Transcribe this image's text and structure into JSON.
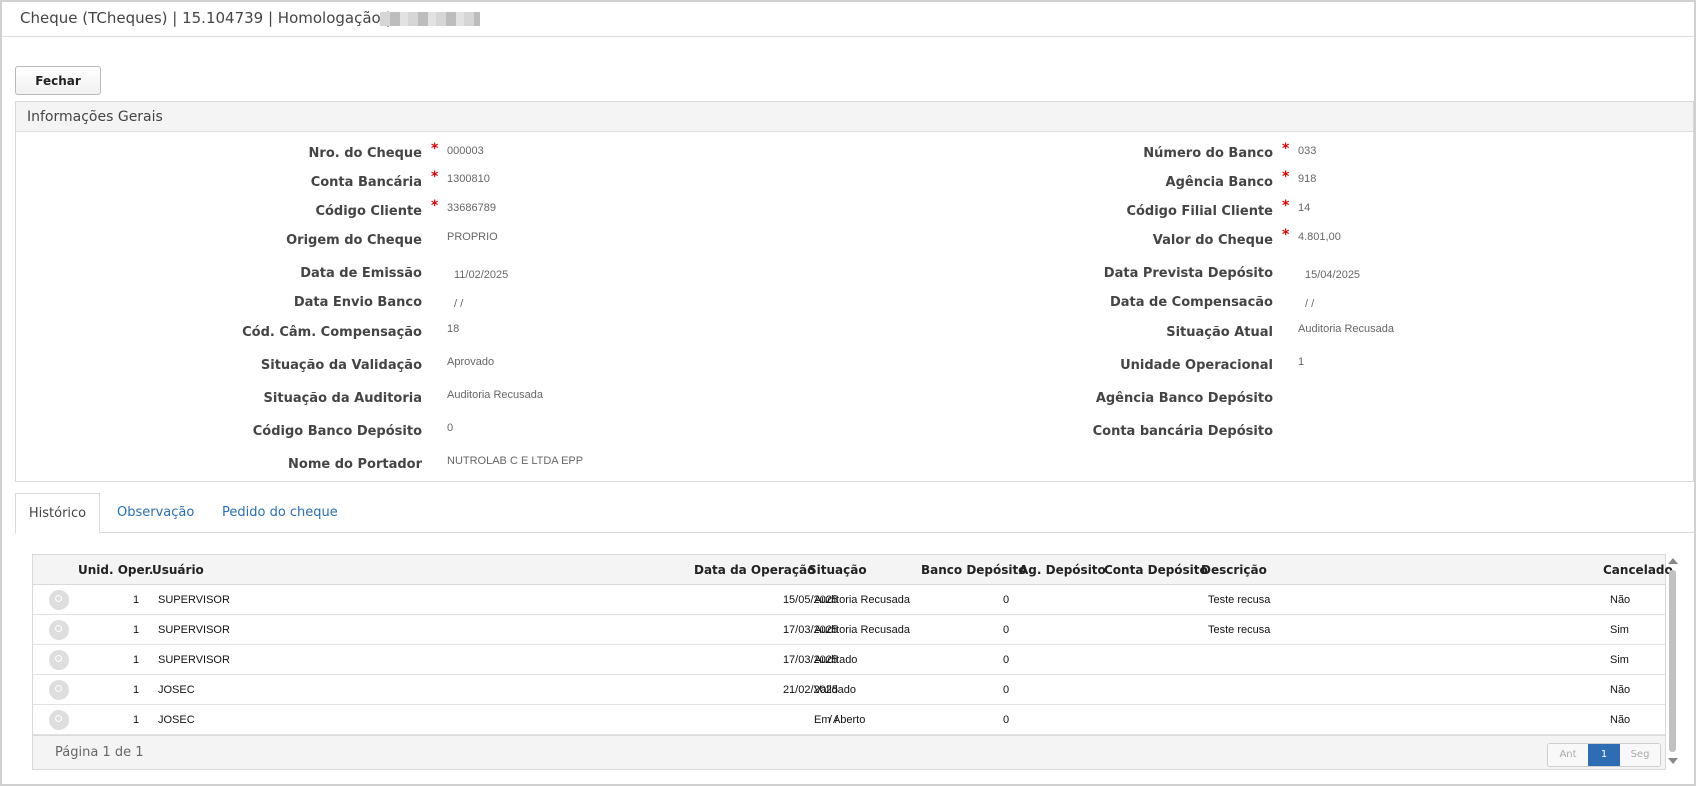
{
  "window": {
    "title": "Cheque (TCheques) | 15.104739 | Homologação |",
    "redacted_icon": "redacted-text"
  },
  "toolbar": {
    "close_label": "Fechar"
  },
  "panel": {
    "title": "Informações Gerais",
    "left_fields": [
      {
        "label": "Nro. do Cheque",
        "value": "000003",
        "required": "*"
      },
      {
        "label": "Conta Bancária",
        "value": "1300810",
        "required": "*"
      },
      {
        "label": "Código Cliente",
        "value": "33686789",
        "required": "*"
      },
      {
        "label": "Origem do Cheque",
        "value": "PROPRIO"
      },
      {
        "label": "Data de Emissão",
        "value": "11/02/2025"
      },
      {
        "label": "Data Envio Banco",
        "value": "/ /"
      },
      {
        "label": "Cód. Câm. Compensação",
        "value": "18"
      },
      {
        "label": "Situação da Validação",
        "value": "Aprovado"
      },
      {
        "label": "Situação da Auditoria",
        "value": "Auditoria Recusada"
      },
      {
        "label": "Código Banco Depósito",
        "value": "0"
      },
      {
        "label": "Nome do Portador",
        "value": "NUTROLAB C E LTDA EPP"
      }
    ],
    "right_fields": [
      {
        "label": "Número do Banco",
        "value": "033",
        "required": "*"
      },
      {
        "label": "Agência Banco",
        "value": "918",
        "required": "*"
      },
      {
        "label": "Código Filial Cliente",
        "value": "14",
        "required": "*"
      },
      {
        "label": "Valor do Cheque",
        "value": "4.801,00",
        "required": "*"
      },
      {
        "label": "Data Prevista Depósito",
        "value": "15/04/2025"
      },
      {
        "label": "Data de Compensacão",
        "value": "/ /"
      },
      {
        "label": "Situação Atual",
        "value": "Auditoria Recusada"
      },
      {
        "label": "Unidade Operacional",
        "value": "1"
      },
      {
        "label": "Agência Banco Depósito",
        "value": ""
      },
      {
        "label": "Conta bancária Depósito",
        "value": ""
      }
    ]
  },
  "tabs": [
    {
      "label": "Histórico",
      "active": true
    },
    {
      "label": "Observação"
    },
    {
      "label": "Pedido do cheque"
    }
  ],
  "history": {
    "columns": [
      "Unid. Oper.",
      "Usuário",
      "Data da Operação",
      "Situação",
      "Banco Depósito",
      "Ag. Depósito",
      "Conta Depósito",
      "Descrição",
      "Cancelado"
    ],
    "row_icon": "magnifier-icon",
    "rows": [
      {
        "unid": "1",
        "usuario": "SUPERVISOR",
        "data": "15/05/2025",
        "situacao": "Auditoria Recusada",
        "banco": "0",
        "ag": "",
        "conta": "",
        "descricao": "Teste recusa",
        "cancelado": "Não"
      },
      {
        "unid": "1",
        "usuario": "SUPERVISOR",
        "data": "17/03/2025",
        "situacao": "Auditoria Recusada",
        "banco": "0",
        "ag": "",
        "conta": "",
        "descricao": "Teste recusa",
        "cancelado": "Sim"
      },
      {
        "unid": "1",
        "usuario": "SUPERVISOR",
        "data": "17/03/2025",
        "situacao": "Auditado",
        "banco": "0",
        "ag": "",
        "conta": "",
        "descricao": "",
        "cancelado": "Sim"
      },
      {
        "unid": "1",
        "usuario": "JOSEC",
        "data": "21/02/2025",
        "situacao": "Validado",
        "banco": "0",
        "ag": "",
        "conta": "",
        "descricao": "",
        "cancelado": "Não"
      },
      {
        "unid": "1",
        "usuario": "JOSEC",
        "data": "/ /",
        "situacao": "Em Aberto",
        "banco": "0",
        "ag": "",
        "conta": "",
        "descricao": "",
        "cancelado": "Não"
      }
    ],
    "footer": {
      "page_info": "Página 1 de 1",
      "prev": "Ant",
      "current": "1",
      "next": "Seg"
    }
  },
  "colors": {
    "accent": "#2e6db4",
    "required": "#e00000",
    "link": "#2a6fb3"
  }
}
